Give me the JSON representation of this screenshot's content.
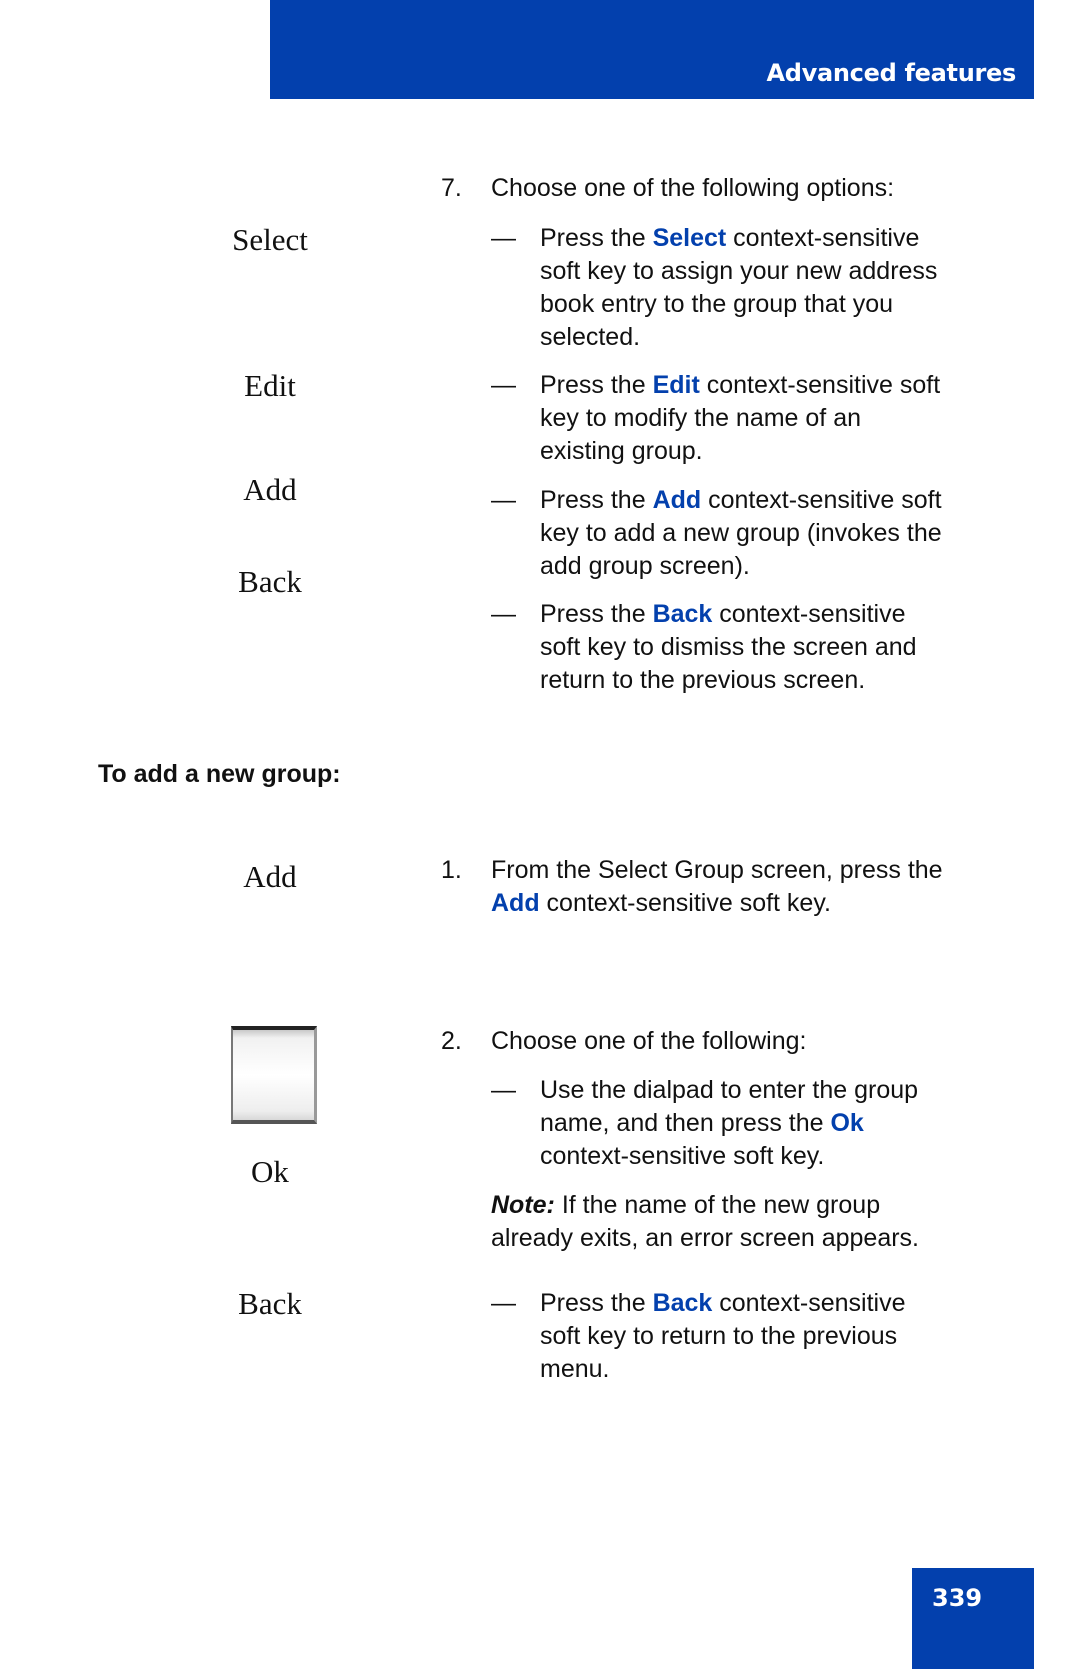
{
  "header": {
    "title": "Advanced features",
    "color": "#0340AD"
  },
  "page_number": "339",
  "left_keys": {
    "k1": "Select",
    "k2": "Edit",
    "k3": "Add",
    "k4": "Back",
    "k5": "Add",
    "k6": "Ok",
    "k7": "Back"
  },
  "step7": {
    "number": "7.",
    "text": "Choose one of the following options:",
    "options": [
      {
        "pre": "Press the ",
        "key": "Select",
        "post_lines": [
          " context-sensitive",
          "soft key to assign your new address",
          "book entry to the group that you",
          "selected."
        ]
      },
      {
        "pre": "Press the ",
        "key": "Edit",
        "post_lines": [
          " context-sensitive soft",
          "key to modify the name of an",
          "existing group."
        ]
      },
      {
        "pre": "Press the ",
        "key": "Add",
        "post_lines": [
          " context-sensitive soft",
          "key to add a new group (invokes the",
          "add group screen)."
        ]
      },
      {
        "pre": "Press the ",
        "key": "Back",
        "post_lines": [
          " context-sensitive",
          "soft key to dismiss the screen and",
          "return to the previous screen."
        ]
      }
    ]
  },
  "section_heading": "To add a new group:",
  "step1": {
    "number": "1.",
    "line1": "From the Select Group screen, press the",
    "key": "Add",
    "line2_post": " context-sensitive soft key."
  },
  "step2": {
    "number": "2.",
    "text": "Choose one of the following:",
    "option1": {
      "line1": "Use the dialpad to enter the group",
      "line2_pre": "name, and then press the ",
      "key": "Ok",
      "line3": "context-sensitive soft key."
    },
    "note": {
      "label": "Note:",
      "line1": " If the name of the new group",
      "line2": "already exits, an error screen appears."
    },
    "option2": {
      "pre": "Press the ",
      "key": "Back",
      "post_lines": [
        " context-sensitive",
        "soft key to return to the previous",
        "menu."
      ]
    }
  },
  "dash": "—"
}
